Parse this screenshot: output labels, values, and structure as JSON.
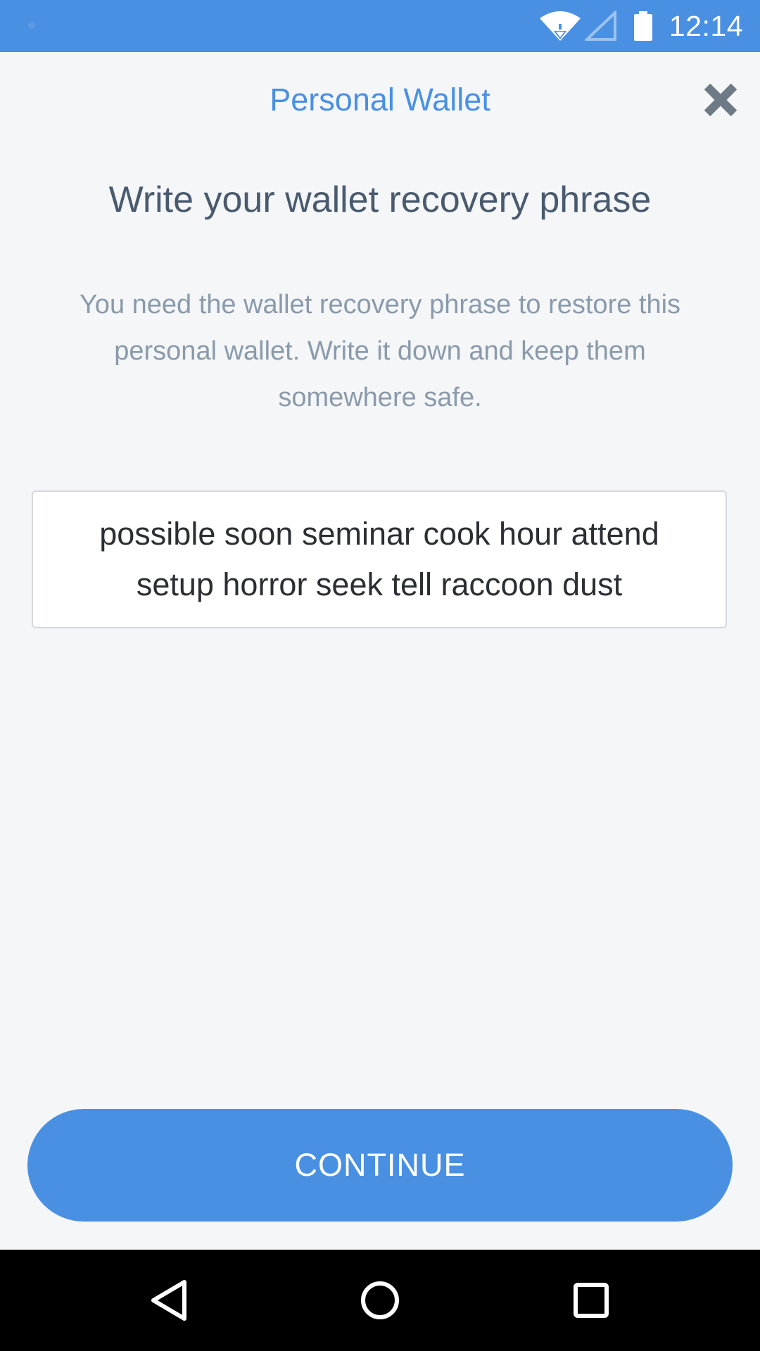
{
  "status_bar": {
    "time": "12:14",
    "icons": [
      "wifi-icon",
      "signal-icon",
      "battery-icon"
    ],
    "background_color": "#4a90e2"
  },
  "header": {
    "title": "Personal Wallet",
    "close_icon": "close-icon"
  },
  "content": {
    "heading": "Write your wallet recovery phrase",
    "description": "You need the wallet recovery phrase to restore this personal wallet. Write it down and keep them somewhere safe.",
    "recovery_phrase": "possible soon seminar cook hour attend setup horror seek tell raccoon dust"
  },
  "actions": {
    "continue_label": "CONTINUE"
  },
  "navigation_bar": {
    "items": [
      "back-icon",
      "home-icon",
      "recents-icon"
    ]
  },
  "colors": {
    "accent": "#4a90e2",
    "background": "#f4f6f8",
    "heading_text": "#4a5a6e",
    "description_text": "#8a9aab"
  }
}
